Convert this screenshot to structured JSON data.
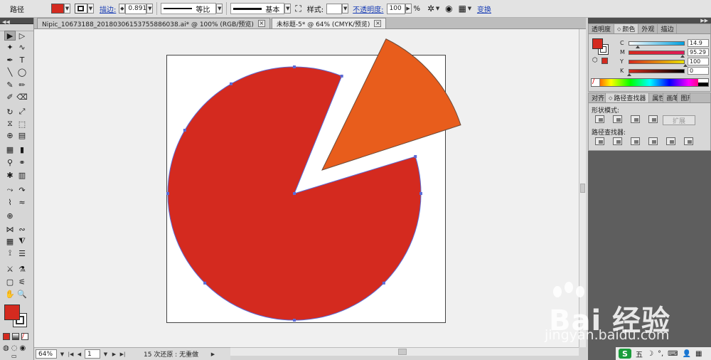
{
  "control_bar": {
    "mode_label": "路径",
    "fill_color": "#d42a1f",
    "stroke_label": "描边:",
    "stroke_weight": "0.891",
    "profile_label": "等比",
    "brush_label": "基本",
    "style_label": "样式:",
    "opacity_label": "不透明度:",
    "opacity_value": "100",
    "opacity_unit": "%",
    "transform_label": "变换"
  },
  "tabs": [
    {
      "label": "Nipic_10673188_20180306153755886038.ai* @ 100% (RGB/预览)",
      "active": false
    },
    {
      "label": "未标题-5* @ 64% (CMYK/预览)",
      "active": true
    }
  ],
  "canvas": {
    "pie_main_color": "#d42a1f",
    "pie_slice_color": "#e85d1c",
    "selection_color": "#5b6bd6"
  },
  "status_bar": {
    "zoom": "64%",
    "page": "1",
    "message": "15 次还原 : 无重做"
  },
  "color_panel": {
    "tabs": [
      "透明度",
      "颜色",
      "外观",
      "描边"
    ],
    "active_tab": "颜色",
    "fill": "#d42a1f",
    "channels": [
      {
        "label": "C",
        "value": "14.9",
        "fraction": 0.149
      },
      {
        "label": "M",
        "value": "95.29",
        "fraction": 0.953
      },
      {
        "label": "Y",
        "value": "100",
        "fraction": 1.0
      },
      {
        "label": "K",
        "value": "0",
        "fraction": 0.0
      }
    ]
  },
  "pathfinder_panel": {
    "tabs": [
      "对齐",
      "路径查找器",
      "属性",
      "画笔",
      "图形"
    ],
    "visible_tabs": [
      "对齐",
      "路径查找器",
      "属性",
      "画笔",
      "图形"
    ],
    "active_tab": "路径查找器",
    "shape_modes_label": "形状模式:",
    "pathfinders_label": "路径查找器:",
    "expand_label": "扩展"
  },
  "watermark": {
    "brand": "Bai 经验",
    "url": "jingyan.baidu.com"
  },
  "tray": {
    "ime": "五"
  }
}
